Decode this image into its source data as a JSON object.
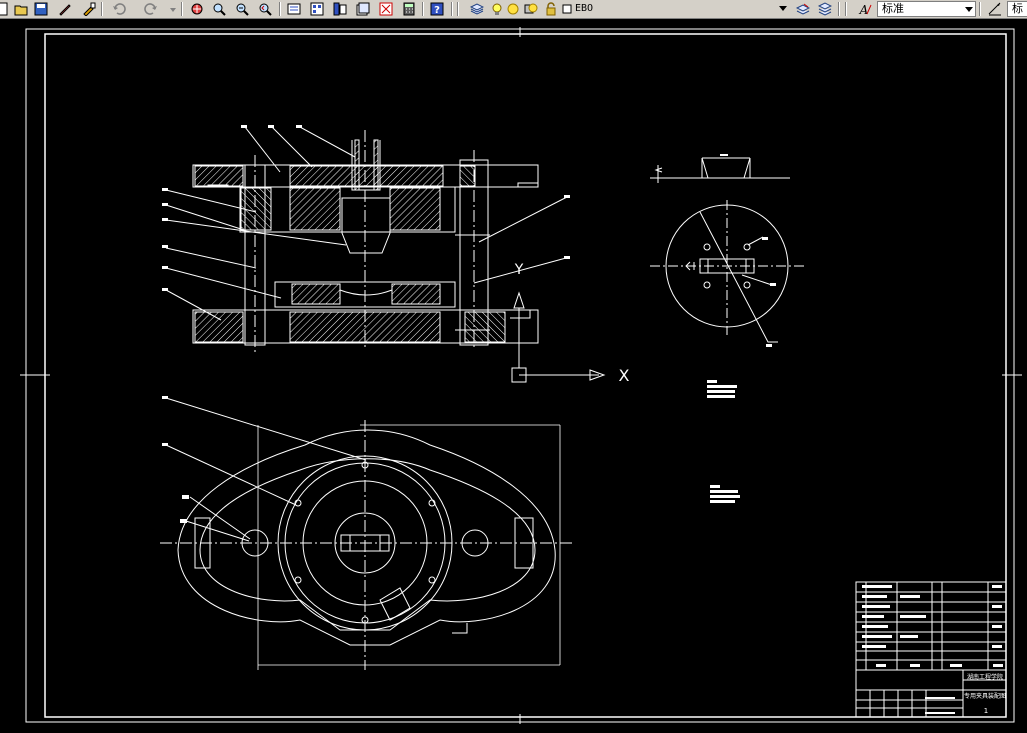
{
  "toolbar": {
    "layer_name": "EBO",
    "text_style": "标准",
    "cut_label": "标"
  },
  "drawing": {
    "colors": {
      "background": "#000000",
      "line": "#ffffff"
    },
    "axis_labels": {
      "y": "Y",
      "x": "X"
    },
    "title_block": {
      "school": "湖南工程学院",
      "drawing_title": "专用夹具装配图",
      "sheet_no": "1"
    }
  }
}
